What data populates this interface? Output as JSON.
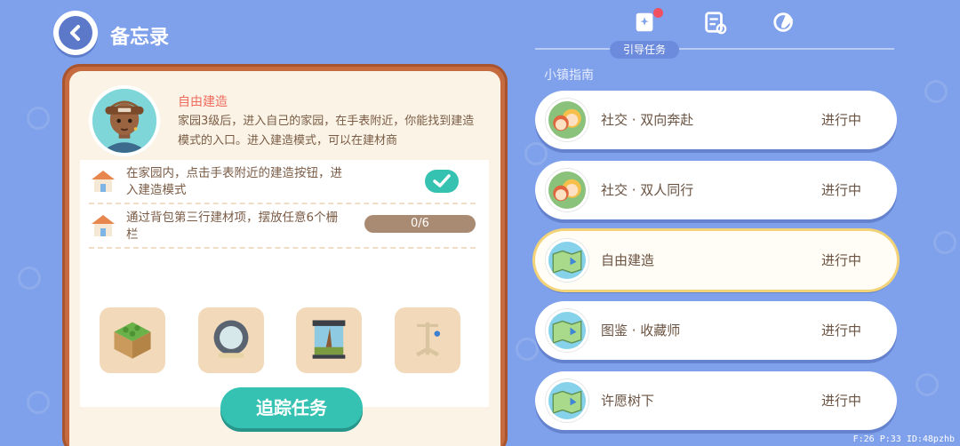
{
  "header": {
    "title": "备忘录"
  },
  "guide": {
    "title": "自由建造",
    "description": "家园3级后，进入自己的家园，在手表附近，你能找到建造模式的入口。进入建造模式，可以在建材商"
  },
  "tasks": [
    {
      "text": "在家园内，点击手表附近的建造按钮，进入建造模式",
      "completed": true
    },
    {
      "text": "通过背包第三行建材项，摆放任意6个栅栏",
      "progress_label": "0/6",
      "progress": 0
    }
  ],
  "rewards": [
    {
      "icon": "grass-block-icon"
    },
    {
      "icon": "hamster-wheel-icon"
    },
    {
      "icon": "terrarium-icon"
    },
    {
      "icon": "bird-perch-icon"
    }
  ],
  "track_button": "追踪任务",
  "tabs": [
    {
      "icon": "guide-book-icon",
      "label": "引导任务",
      "active": true,
      "badge": true
    },
    {
      "icon": "task-list-icon",
      "active": false
    },
    {
      "icon": "note-edit-icon",
      "active": false
    }
  ],
  "section_title": "小镇指南",
  "quests": [
    {
      "name": "社交 · 双向奔赴",
      "status": "进行中",
      "icon": "friends-icon",
      "selected": false
    },
    {
      "name": "社交 · 双人同行",
      "status": "进行中",
      "icon": "friends-icon",
      "selected": false
    },
    {
      "name": "自由建造",
      "status": "进行中",
      "icon": "map-icon",
      "selected": true
    },
    {
      "name": "图鉴 · 收藏师",
      "status": "进行中",
      "icon": "map-icon",
      "selected": false
    },
    {
      "name": "许愿树下",
      "status": "进行中",
      "icon": "map-icon",
      "selected": false
    }
  ],
  "debug": "F:26   P:33   ID:48pzhb",
  "colors": {
    "background": "#7fa0ea",
    "accent": "#36c2b2",
    "frame": "#c56b3f",
    "title_red": "#ee6b5e"
  }
}
